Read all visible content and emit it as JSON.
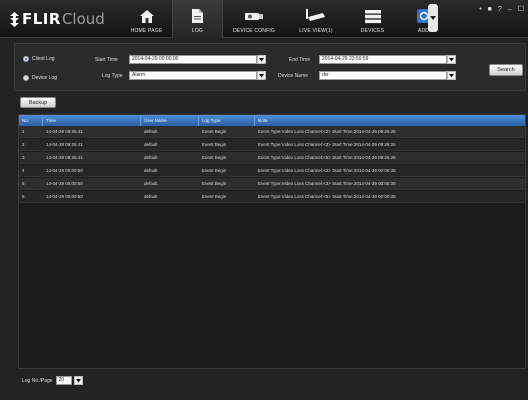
{
  "header": {
    "logo_brand": "FLIR",
    "logo_product": "Cloud",
    "nav": [
      {
        "label": "HOME PAGE",
        "icon": "home-icon",
        "active": false
      },
      {
        "label": "LOG",
        "icon": "document-icon",
        "active": true
      },
      {
        "label": "DEVICE CONFIG",
        "icon": "camera-config-icon",
        "active": false
      },
      {
        "label": "LIVE VIEW(1)",
        "icon": "camera-live-icon",
        "active": false
      },
      {
        "label": "DEVICES",
        "icon": "dvr-icon",
        "active": false
      },
      {
        "label": "ADD",
        "icon": "add-icon",
        "active": false
      }
    ],
    "window_controls": [
      "•",
      "■",
      "?",
      "–",
      "☐"
    ]
  },
  "filter": {
    "radio_client_log": "Client Log",
    "radio_device_log": "Device Log",
    "start_time_label": "Start Time",
    "start_time_value": "2014-04-29 00:00:00",
    "end_time_label": "End Time",
    "end_time_value": "2014-04-29 23:59:59",
    "log_type_label": "Log Type",
    "log_type_value": "Alarm",
    "device_name_label": "Device Name",
    "device_name_value": "dvr",
    "search_label": "Search"
  },
  "backup_label": "Backup",
  "table": {
    "columns": [
      "No.",
      "Time",
      "User Name",
      "Log Type",
      "Note"
    ],
    "rows": [
      [
        "1",
        "14-04-29 09:26:41",
        "default",
        "Event Begin",
        "Event Type:Video Loss Channel:<2> Start Time:2014-04-29 09:26:26"
      ],
      [
        "2",
        "14-04-29 09:26:41",
        "default",
        "Event Begin",
        "Event Type:Video Loss Channel:<3> Start Time:2014-04-29 09:26:26"
      ],
      [
        "3",
        "14-04-29 09:26:41",
        "default",
        "Event Begin",
        "Event Type:Video Loss Channel:<5> Start Time:2014-04-29 09:26:26"
      ],
      [
        "4",
        "14-04-29 00:00:50",
        "default",
        "Event Begin",
        "Event Type:Video Loss Channel:<2> Start Time:2014-04-29 00:00:35"
      ],
      [
        "5",
        "14-04-29 00:00:50",
        "default",
        "Event Begin",
        "Event Type:Video Loss Channel:<3> Start Time:2014-04-29 00:00:35"
      ],
      [
        "6",
        "14-04-29 00:00:50",
        "default",
        "Event Begin",
        "Event Type:Video Loss Channel:<5> Start Time:2014-04-29 00:00:35"
      ]
    ]
  },
  "footer": {
    "per_page_label": "Log No./Page",
    "per_page_value": "20"
  },
  "colors": {
    "table_header": "#3b78c4",
    "add_icon": "#2f6fd6",
    "background": "#232323"
  }
}
